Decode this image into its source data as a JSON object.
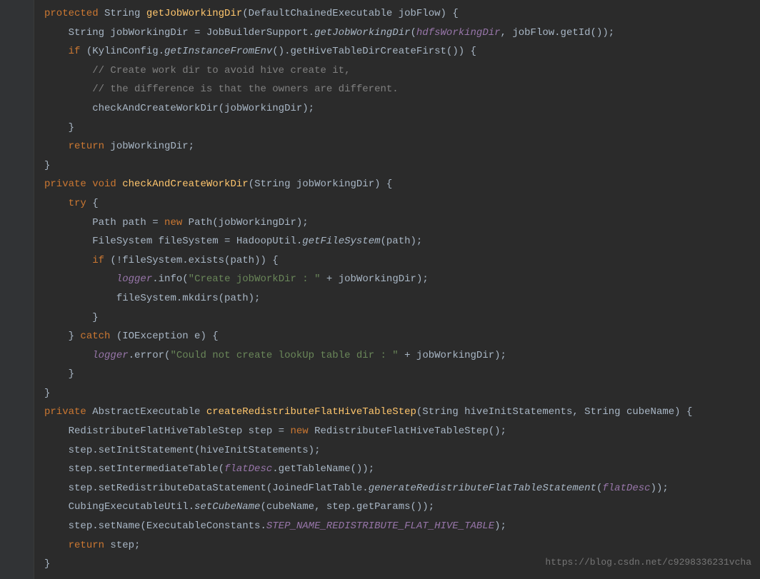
{
  "code": {
    "l1": {
      "kw1": "protected",
      "t1": " String ",
      "m": "getJobWorkingDir",
      "p": "(DefaultChainedExecutable jobFlow) {"
    },
    "l2": {
      "a": "String jobWorkingDir = JobBuilderSupport.",
      "sm": "getJobWorkingDir",
      "b": "(",
      "f": "hdfsWorkingDir",
      "c": ", jobFlow.getId());"
    },
    "l3": {
      "kw": "if",
      "a": " (KylinConfig.",
      "sm": "getInstanceFromEnv",
      "b": "().getHiveTableDirCreateFirst()) {"
    },
    "l4": {
      "c": "// Create work dir to avoid hive create it,"
    },
    "l5": {
      "c": "// the difference is that the owners are different."
    },
    "l6": {
      "a": "checkAndCreateWorkDir(jobWorkingDir);"
    },
    "l7": {
      "a": "}"
    },
    "l8": {
      "kw": "return",
      "a": " jobWorkingDir;"
    },
    "l9": {
      "a": "}"
    },
    "l10": {
      "kw1": "private",
      "kw2": " void ",
      "m": "checkAndCreateWorkDir",
      "p": "(String jobWorkingDir) {"
    },
    "l11": {
      "kw": "try",
      "a": " {"
    },
    "l12": {
      "a": "Path path = ",
      "kw": "new",
      "b": " Path(jobWorkingDir);"
    },
    "l13": {
      "a": "FileSystem fileSystem = HadoopUtil.",
      "sm": "getFileSystem",
      "b": "(path);"
    },
    "l14": {
      "kw": "if",
      "a": " (!fileSystem.exists(path)) {"
    },
    "l15": {
      "f": "logger",
      "a": ".info(",
      "s": "\"Create jobWorkDir : \"",
      "b": " + jobWorkingDir);"
    },
    "l16": {
      "a": "fileSystem.mkdirs(path);"
    },
    "l17": {
      "a": "}"
    },
    "l18": {
      "a": "} ",
      "kw": "catch",
      "b": " (IOException e) {"
    },
    "l19": {
      "f": "logger",
      "a": ".error(",
      "s": "\"Could not create lookUp table dir : \"",
      "b": " + jobWorkingDir);"
    },
    "l20": {
      "a": "}"
    },
    "l21": {
      "a": "}"
    },
    "l22": {
      "kw1": "private",
      "t1": " AbstractExecutable ",
      "m": "createRedistributeFlatHiveTableStep",
      "p": "(String hiveInitStatements, String cubeName) {"
    },
    "l23": {
      "a": "RedistributeFlatHiveTableStep step = ",
      "kw": "new",
      "b": " RedistributeFlatHiveTableStep();"
    },
    "l24": {
      "a": "step.setInitStatement(hiveInitStatements);"
    },
    "l25": {
      "a": "step.setIntermediateTable(",
      "f": "flatDesc",
      "b": ".getTableName());"
    },
    "l26": {
      "a": "step.setRedistributeDataStatement(JoinedFlatTable.",
      "sm": "generateRedistributeFlatTableStatement",
      "b": "(",
      "f": "flatDesc",
      "c": "));"
    },
    "l27": {
      "a": "CubingExecutableUtil.",
      "sm": "setCubeName",
      "b": "(cubeName, step.getParams());"
    },
    "l28": {
      "a": "step.setName(ExecutableConstants.",
      "cn": "STEP_NAME_REDISTRIBUTE_FLAT_HIVE_TABLE",
      "b": ");"
    },
    "l29": {
      "kw": "return",
      "a": " step;"
    },
    "l30": {
      "a": "}"
    }
  },
  "watermark": "https://blog.csdn.net/c9298336231vcha"
}
